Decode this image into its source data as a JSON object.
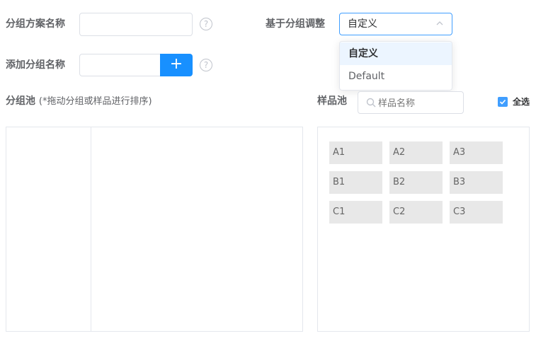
{
  "form": {
    "scheme_name_label": "分组方案名称",
    "scheme_name_value": "",
    "add_group_label": "添加分组名称",
    "add_group_value": "",
    "add_button_label": "+",
    "help_glyph": "?",
    "based_on_label": "基于分组调整",
    "based_on_selected": "自定义",
    "based_on_options": [
      "自定义",
      "Default"
    ]
  },
  "group_pool": {
    "title": "分组池",
    "hint": "(*拖动分组或样品进行排序)"
  },
  "sample_pool": {
    "title": "样品池",
    "search_placeholder": "样品名称",
    "select_all_label": "全选",
    "select_all_checked": true,
    "samples": [
      "A1",
      "A2",
      "A3",
      "B1",
      "B2",
      "B3",
      "C1",
      "C2",
      "C3"
    ]
  },
  "colors": {
    "primary": "#409eff",
    "button": "#1890ff",
    "chip_bg": "#e8e8e8"
  }
}
